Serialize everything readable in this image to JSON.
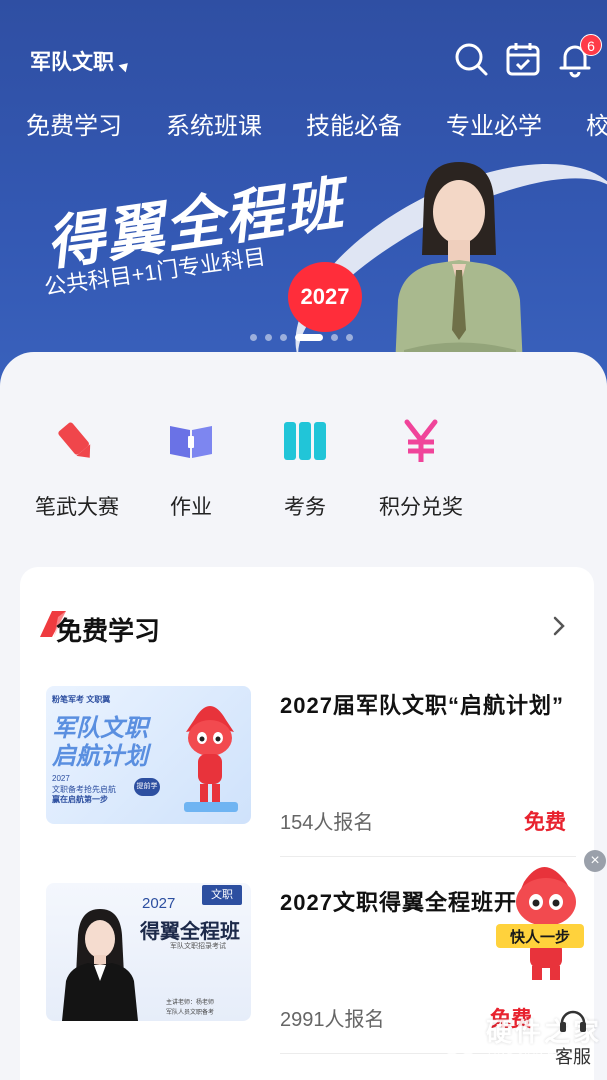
{
  "header": {
    "location": "军队文职",
    "notification_count": "6"
  },
  "tabs": [
    "免费学习",
    "系统班课",
    "技能必备",
    "专业必学",
    "校"
  ],
  "banner": {
    "title": "得翼全程班",
    "subtitle": "公共科目+1门专业科目",
    "year_badge": "2027",
    "slide_count": 6,
    "active_slide": 4
  },
  "quick_links": [
    {
      "label": "笔武大赛",
      "icon": "pencil-icon",
      "color": "#f0464b"
    },
    {
      "label": "作业",
      "icon": "book-icon",
      "color": "#6a72e6"
    },
    {
      "label": "考务",
      "icon": "columns-icon",
      "color": "#21c5d8"
    },
    {
      "label": "积分兑奖",
      "icon": "yen-icon",
      "color": "#f0449a"
    }
  ],
  "free_section": {
    "title": "免费学习",
    "courses": [
      {
        "title": "2027届军队文职“启航计划”",
        "enrolled": "154人报名",
        "price": "免费",
        "thumb": {
          "brand": "粉笔军考 文职翼",
          "headline1": "军队文职",
          "headline2": "启航计划",
          "line1": "2027",
          "line2": "文职备考抢先启航",
          "line3": "赢在启航第一步",
          "tag": "提前学"
        }
      },
      {
        "title": "2027文职得翼全程班开课",
        "enrolled": "2991人报名",
        "price": "免费",
        "thumb": {
          "year": "2027",
          "tag": "文职",
          "headline": "得翼全程班",
          "sub": "军队文职招录考试",
          "teacher": "主讲老师：杨老师",
          "footer": "军队人员文职备考"
        }
      }
    ]
  },
  "floating": {
    "mascot_sign": "快人一步",
    "close": "×"
  },
  "service": {
    "label": "客服"
  },
  "watermark": {
    "text": "硬件之家",
    "sub": "YING JIAN ZHI JIA"
  },
  "colors": {
    "brand_blue": "#3459b4",
    "price_red": "#e8222e"
  }
}
